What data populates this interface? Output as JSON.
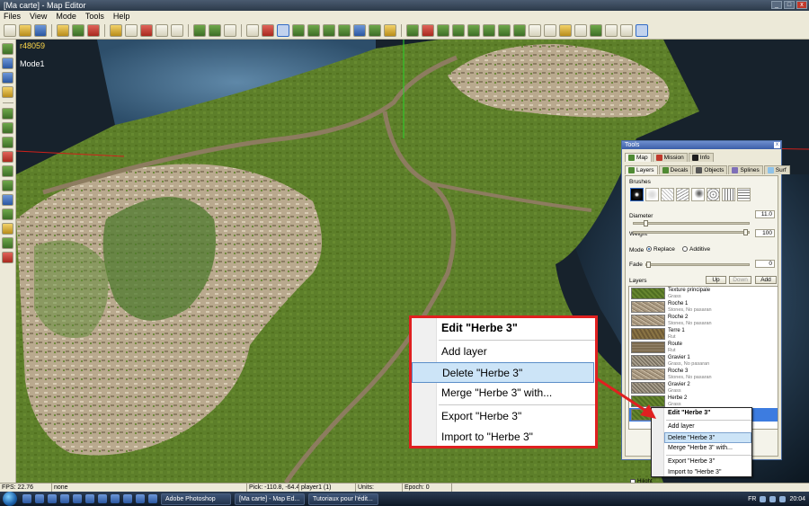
{
  "window": {
    "title": "[Ma carte] - Map Editor",
    "controls": [
      "_",
      "□",
      "x"
    ]
  },
  "menubar": [
    "Files",
    "View",
    "Mode",
    "Tools",
    "Help"
  ],
  "viewport": {
    "map_id": "r48059",
    "mode_label": "Mode1"
  },
  "tools_panel": {
    "title": "Tools",
    "close": "x",
    "main_tabs": [
      {
        "label": "Map",
        "icon": "map-icon"
      },
      {
        "label": "Mission",
        "icon": "mission-icon"
      },
      {
        "label": "Info",
        "icon": "info-icon"
      }
    ],
    "sub_tabs": [
      {
        "label": "Layers",
        "icon": "layers-icon"
      },
      {
        "label": "Decals",
        "icon": "decals-icon"
      },
      {
        "label": "Objects",
        "icon": "objects-icon"
      },
      {
        "label": "Splines",
        "icon": "splines-icon"
      },
      {
        "label": "Surf",
        "icon": "surf-icon"
      }
    ],
    "brushes_label": "Brushes",
    "diameter_label": "Diameter",
    "diameter_value": "11.0",
    "diameter_fraction": 0.09,
    "weight_label": "Weight",
    "weight_value": "100",
    "weight_fraction": 1.0,
    "mode_label": "Mode",
    "mode_options": [
      "Replace",
      "Additive"
    ],
    "mode_selected": "Replace",
    "fade_label": "Fade",
    "fade_value": "0",
    "fade_fraction": 0.0,
    "layers_label": "Layers",
    "layer_buttons": {
      "up": "Up",
      "down": "Down",
      "add": "Add"
    },
    "layers": [
      {
        "name": "Texture principale",
        "desc": "Grass"
      },
      {
        "name": "Roche 1",
        "desc": "Stones, No pasaran"
      },
      {
        "name": "Roche 2",
        "desc": "Stones, No pasaran"
      },
      {
        "name": "Terre 1",
        "desc": "Rut"
      },
      {
        "name": "Route",
        "desc": "Rut"
      },
      {
        "name": "Gravier 1",
        "desc": "Grass, No pasaran"
      },
      {
        "name": "Roche 3",
        "desc": "Stones, No pasaran"
      },
      {
        "name": "Gravier 2",
        "desc": "Grass"
      },
      {
        "name": "Herbe 2",
        "desc": "Grass"
      },
      {
        "name": "",
        "desc": ""
      }
    ],
    "hilight_label": "Hilight"
  },
  "context_menu": {
    "title": "Edit \"Herbe 3\"",
    "items": [
      "Add layer",
      "Delete \"Herbe 3\"",
      "Merge \"Herbe 3\" with...",
      "Export \"Herbe 3\"",
      "Import to \"Herbe 3\""
    ],
    "highlighted": "Delete \"Herbe 3\""
  },
  "statusbar": {
    "fps": "FPS: 22.76",
    "selection": "none",
    "pick": "Pick: -110.8, -64.4, 222.0",
    "player": "player1 (1)",
    "units": "Units:",
    "epoch": "Epoch: 0"
  },
  "taskbar": {
    "tasks": [
      "Adobe Photoshop",
      "[Ma carte] - Map Ed...",
      "Tutoriaux pour l'édit..."
    ],
    "lang": "FR",
    "clock": "20:04"
  },
  "colors": {
    "highlight_red": "#e02020",
    "selection_blue": "#3d7ce0",
    "menu_hover": "#cce4f7"
  }
}
